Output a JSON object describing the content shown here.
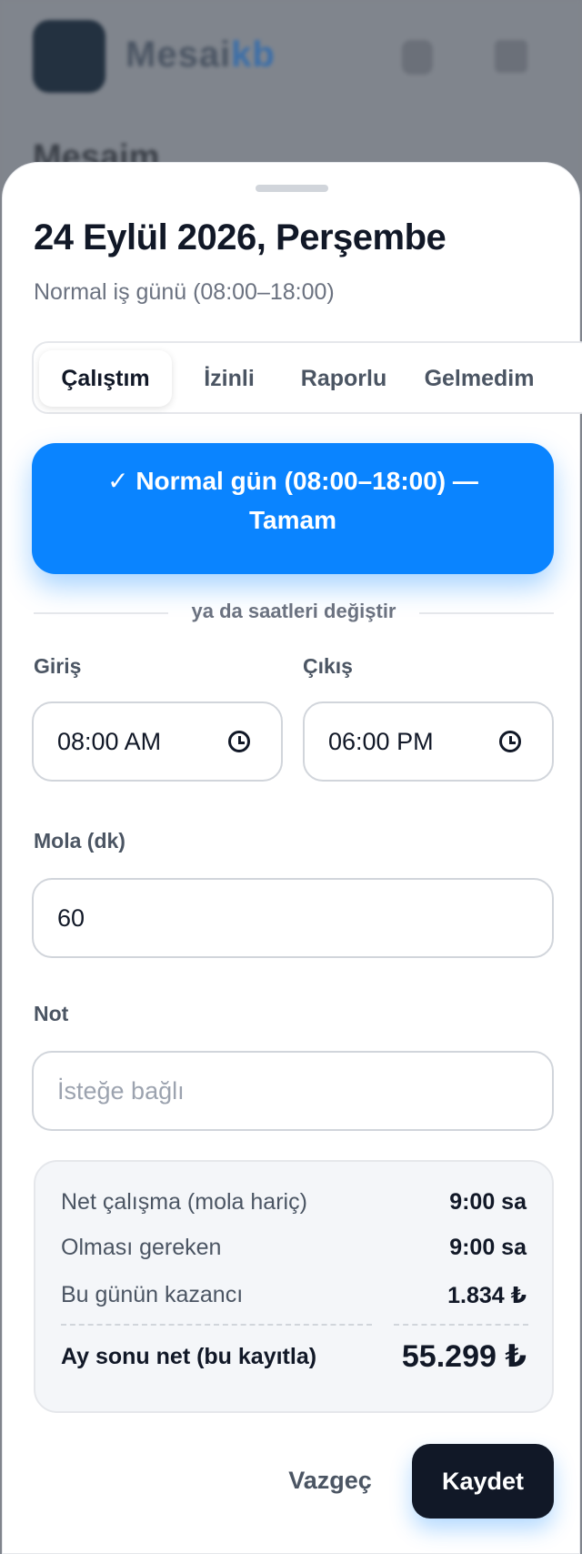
{
  "background": {
    "brand_left": "Mesai",
    "brand_right": "kb",
    "title": "Mesaim"
  },
  "sheet": {
    "title": "24 Eylül 2026, Perşembe",
    "subtitle": "Normal iş günü (08:00–18:00)"
  },
  "tabs": [
    {
      "label": "Çalıştım",
      "active": true
    },
    {
      "label": "İzinli",
      "active": false
    },
    {
      "label": "Raporlu",
      "active": false
    },
    {
      "label": "Gelmedim",
      "active": false
    }
  ],
  "quick_action": {
    "line1": "✓ Normal gün (08:00–18:00) —",
    "line2": "Tamam"
  },
  "divider_text": "ya da saatleri değiştir",
  "form": {
    "entry_label": "Giriş",
    "entry_value": "08:00 AM",
    "exit_label": "Çıkış",
    "exit_value": "06:00 PM",
    "break_label": "Mola (dk)",
    "break_value": "60",
    "note_label": "Not",
    "note_placeholder": "İsteğe bağlı"
  },
  "summary": {
    "rows": [
      {
        "label": "Net çalışma (mola hariç)",
        "value": "9:00 sa"
      },
      {
        "label": "Olması gereken",
        "value": "9:00 sa"
      },
      {
        "label": "Bu günün kazancı",
        "value": "1.834 ₺"
      }
    ],
    "total_label": "Ay sonu net (bu kayıtla)",
    "total_value": "55.299 ₺"
  },
  "actions": {
    "cancel_label": "Vazgeç",
    "save_label": "Kaydet"
  },
  "colors": {
    "accent": "#0a84ff",
    "dark": "#111827"
  }
}
